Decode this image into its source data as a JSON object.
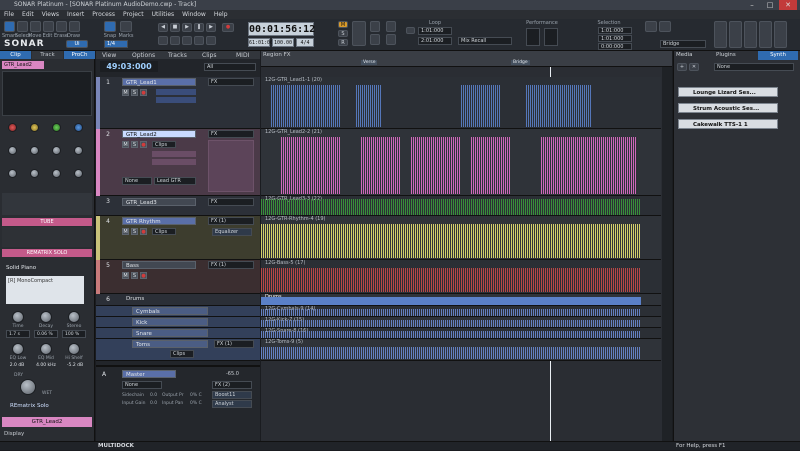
{
  "window": {
    "title": "SONAR Platinum - [SONAR Platinum AudioDemo.cwp - Track]",
    "controls": [
      "–",
      "□",
      "✕"
    ]
  },
  "menu": [
    "File",
    "Edit",
    "Views",
    "Insert",
    "Process",
    "Project",
    "Utilities",
    "Window",
    "Help"
  ],
  "control_bar": {
    "brand": "SONAR",
    "tool_labels": [
      "Smart",
      "Select",
      "Move",
      "Edit",
      "Erase",
      "Draw"
    ],
    "tool_mode": "Ui",
    "snap_label": "Snap",
    "marks_label": "Marks",
    "snap_value": "1/4",
    "time": "00:01:56:12",
    "measure": "61:01:000",
    "tempo": "100.00",
    "meter": "4/4",
    "loop_label": "Loop",
    "loop_start": "1:01:000",
    "loop_end": "2:01:000",
    "mix_recall": "Mix Recall",
    "performance_label": "Performance",
    "selection_label": "Selection",
    "selection_start": "1:01:000",
    "selection_end": "1:01:000",
    "selection_len": "0:00:000",
    "bridge": "Bridge"
  },
  "inspector": {
    "tabs": [
      "Clip",
      "Track",
      "ProCh"
    ],
    "track_name": "GTR_Lead2",
    "tube_label": "TUBE",
    "rematrix_label": "REMATRIX SOLO",
    "preset": "Solid Piano",
    "mono_compact": "[R] MonoCompact",
    "knob_labels_1": [
      "Time",
      "Decay",
      "Stereo"
    ],
    "knob_values_1": [
      "1.7 s",
      "0.06 %",
      "100 %"
    ],
    "knob_labels_2": [
      "EQ Low",
      "EQ Mid",
      "Hi Shelf"
    ],
    "knob_values_2": [
      "2.0 dB",
      "4.00 kHz",
      "-5.2 dB"
    ],
    "dry_label": "DRY",
    "wet_label": "WET",
    "remat_logo": "REmatrix Solo",
    "footer_name": "GTR_Lead2",
    "display_label": "Display"
  },
  "tracks_header": {
    "time": "49:03:000",
    "menus": [
      "View",
      "Options",
      "Tracks",
      "Clips",
      "MIDI"
    ],
    "filter": "All",
    "region": "Region FX"
  },
  "tracks": [
    {
      "num": "1",
      "name": "GTR_Lead1",
      "color": "#7a86b8",
      "fx": "FX",
      "clips": "Clips"
    },
    {
      "num": "2",
      "name": "GTR_Lead2",
      "color": "#d987c2",
      "fx": "FX",
      "clips": "Clips",
      "input": "None",
      "output": "Lead GTR"
    },
    {
      "num": "3",
      "name": "GTR_Lead3",
      "color": "#5a6a86",
      "fx": "FX"
    },
    {
      "num": "4",
      "name": "GTR Rhythm",
      "color": "#c8c27a",
      "fx": "FX (1)",
      "clips": "Clips",
      "eq": "Equalizer"
    },
    {
      "num": "5",
      "name": "Bass",
      "color": "#c87a7a",
      "fx": "FX (1)"
    },
    {
      "num": "6",
      "name": "Drums",
      "color": "#4d5566"
    },
    {
      "num": "",
      "name": "Cymbals",
      "color": "#6b7fb3"
    },
    {
      "num": "",
      "name": "Kick",
      "color": "#6b7fb3"
    },
    {
      "num": "",
      "name": "Snare",
      "color": "#6b7fb3"
    },
    {
      "num": "",
      "name": "Toms",
      "color": "#6b7fb3",
      "fx": "FX (1)",
      "clips": "Clips"
    }
  ],
  "bus": {
    "label": "A",
    "name": "Master",
    "volume": "-65.0",
    "input": "None",
    "fx": "FX (2)",
    "boost": "Boost11",
    "analyst": "Analyst",
    "params": [
      "Sidechain",
      "0.0",
      "Output Pr",
      "0% C",
      "Input Gain",
      "0.0",
      "Input Pan",
      "0% C"
    ]
  },
  "clips": [
    {
      "label": "12G-GTR_Lead1-1 (20)",
      "color": "#5a7fc8"
    },
    {
      "label": "12G-GTR_Lead2-2 (21)",
      "color": "#e06cc8"
    },
    {
      "label": "12G-GTR_Lead3-3 (22)",
      "color": "#3a9a3a"
    },
    {
      "label": "12G-GTR-Rhythm-4 (19)",
      "color": "#e4e070"
    },
    {
      "label": "12G-Bass-5 (17)",
      "color": "#c84848"
    },
    {
      "label": "Drums",
      "color": "#5a80c8"
    },
    {
      "label": "12G-Cymbals-9 (14)",
      "color": "#6a88d0"
    },
    {
      "label": "12G-Kick-7 (15)",
      "color": "#6a88d0"
    },
    {
      "label": "12G-Snare-8 (16)",
      "color": "#6a88d0"
    },
    {
      "label": "12G-Toms-9 (5)",
      "color": "#6a88d0"
    }
  ],
  "ruler": {
    "bridge_marker": "Bridge",
    "verse_marker": "Verse"
  },
  "browser": {
    "tabs": [
      "Media",
      "Plugins",
      "Synth"
    ],
    "filter": "None",
    "items": [
      "Lounge Lizard Ses...",
      "Strum Acoustic Ses...",
      "Cakewalk TTS-1 1"
    ]
  },
  "status": {
    "multidock": "MULTIDOCK",
    "help": "For Help, press F1"
  },
  "colors": {
    "accent": "#3b8de0",
    "record": "#d23c3c"
  }
}
